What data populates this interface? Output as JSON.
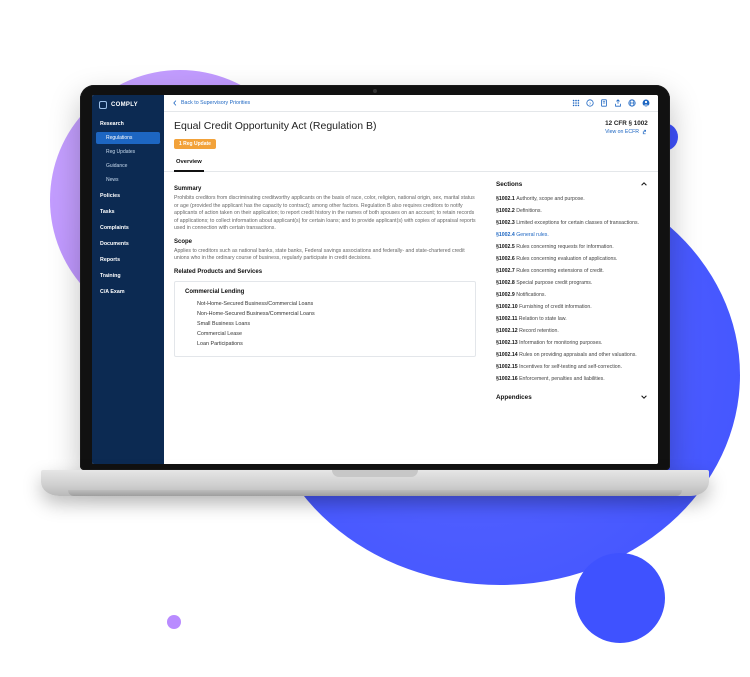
{
  "brand": "COMPLY",
  "sidebar": {
    "items": [
      {
        "label": "Research",
        "top": true
      },
      {
        "label": "Regulations",
        "sub": true,
        "active": true
      },
      {
        "label": "Reg Updates",
        "sub": true
      },
      {
        "label": "Guidance",
        "sub": true
      },
      {
        "label": "News",
        "sub": true
      },
      {
        "label": "Policies",
        "top": true
      },
      {
        "label": "Tasks",
        "top": true
      },
      {
        "label": "Complaints",
        "top": true
      },
      {
        "label": "Documents",
        "top": true
      },
      {
        "label": "Reports",
        "top": true
      },
      {
        "label": "Training",
        "top": true
      },
      {
        "label": "C/A Exam",
        "top": true
      }
    ]
  },
  "backlink": "Back to Supervisory Priorities",
  "header": {
    "title": "Equal Credit Opportunity Act (Regulation B)",
    "badge": "1 Reg Update",
    "cfr": "12 CFR § 1002",
    "ecfr": "View on ECFR"
  },
  "tabs": {
    "overview": "Overview"
  },
  "summary": {
    "heading": "Summary",
    "text": "Prohibits creditors from discriminating creditworthy applicants on the basis of race, color, religion, national origin, sex, marital status or age (provided the applicant has the capacity to contract); among other factors. Regulation B also requires creditors to notify applicants of action taken on their application; to report credit history in the names of both spouses on an account; to retain records of applications; to collect information about applicant(s) for certain loans; and to provide applicant(s) with copies of appraisal reports used in connection with certain transactions."
  },
  "scope": {
    "heading": "Scope",
    "text": "Applies to creditors such as national banks, state banks, Federal savings associations and federally- and state-chartered credit unions who in the ordinary course of business, regularly participate in credit decisions."
  },
  "related": {
    "heading": "Related Products and Services",
    "group": "Commercial Lending",
    "items": [
      "Not-Home-Secured Business/Commercial Loans",
      "Non-Home-Secured Business/Commercial Loans",
      "Small Business Loans",
      "Commercial Lease",
      "Loan Participations"
    ]
  },
  "sections": {
    "heading": "Sections",
    "items": [
      {
        "num": "§1002.1",
        "title": "Authority, scope and purpose."
      },
      {
        "num": "§1002.2",
        "title": "Definitions."
      },
      {
        "num": "§1002.3",
        "title": "Limited exceptions for certain classes of transactions."
      },
      {
        "num": "§1002.4",
        "title": "General rules.",
        "current": true
      },
      {
        "num": "§1002.5",
        "title": "Rules concerning requests for information."
      },
      {
        "num": "§1002.6",
        "title": "Rules concerning evaluation of applications."
      },
      {
        "num": "§1002.7",
        "title": "Rules concerning extensions of credit."
      },
      {
        "num": "§1002.8",
        "title": "Special purpose credit programs."
      },
      {
        "num": "§1002.9",
        "title": "Notifications."
      },
      {
        "num": "§1002.10",
        "title": "Furnishing of credit information."
      },
      {
        "num": "§1002.11",
        "title": "Relation to state law."
      },
      {
        "num": "§1002.12",
        "title": "Record retention."
      },
      {
        "num": "§1002.13",
        "title": "Information for monitoring purposes."
      },
      {
        "num": "§1002.14",
        "title": "Rules on providing appraisals and other valuations."
      },
      {
        "num": "§1002.15",
        "title": "Incentives for self-testing and self-correction."
      },
      {
        "num": "§1002.16",
        "title": "Enforcement, penalties and liabilities."
      }
    ],
    "appendices": "Appendices"
  }
}
